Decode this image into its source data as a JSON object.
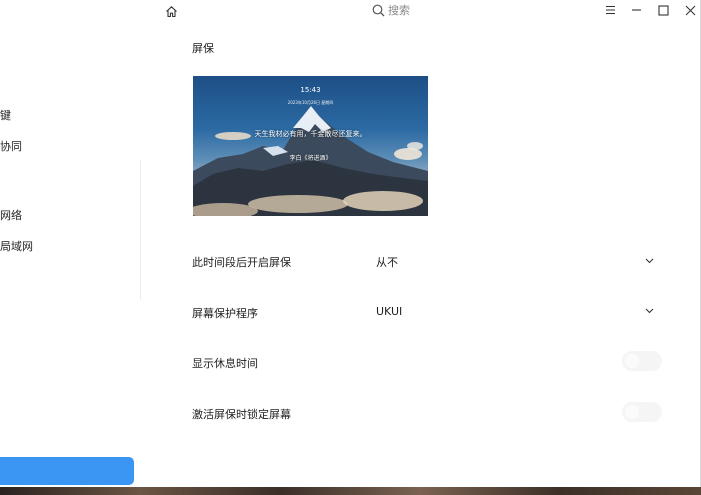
{
  "sidebar": {
    "items": [
      {
        "label": "键"
      },
      {
        "label": "协同"
      },
      {
        "label": "网络"
      },
      {
        "label": "局域网"
      }
    ]
  },
  "header": {
    "search_placeholder": "搜索"
  },
  "screensaver": {
    "title": "屏保",
    "preview": {
      "time": "15:43",
      "date": "2023年10月26日 星期四",
      "quote": "天生我材必有用，千金散尽还复来。",
      "author": "李白《将进酒》"
    },
    "rows": [
      {
        "label": "此时间段后开启屏保",
        "value": "从不"
      },
      {
        "label": "屏幕保护程序",
        "value": "UKUI"
      },
      {
        "label": "显示休息时间",
        "toggle": false
      },
      {
        "label": "激活屏保时锁定屏幕",
        "toggle": false
      }
    ]
  },
  "colors": {
    "accent": "#3b95f3"
  }
}
